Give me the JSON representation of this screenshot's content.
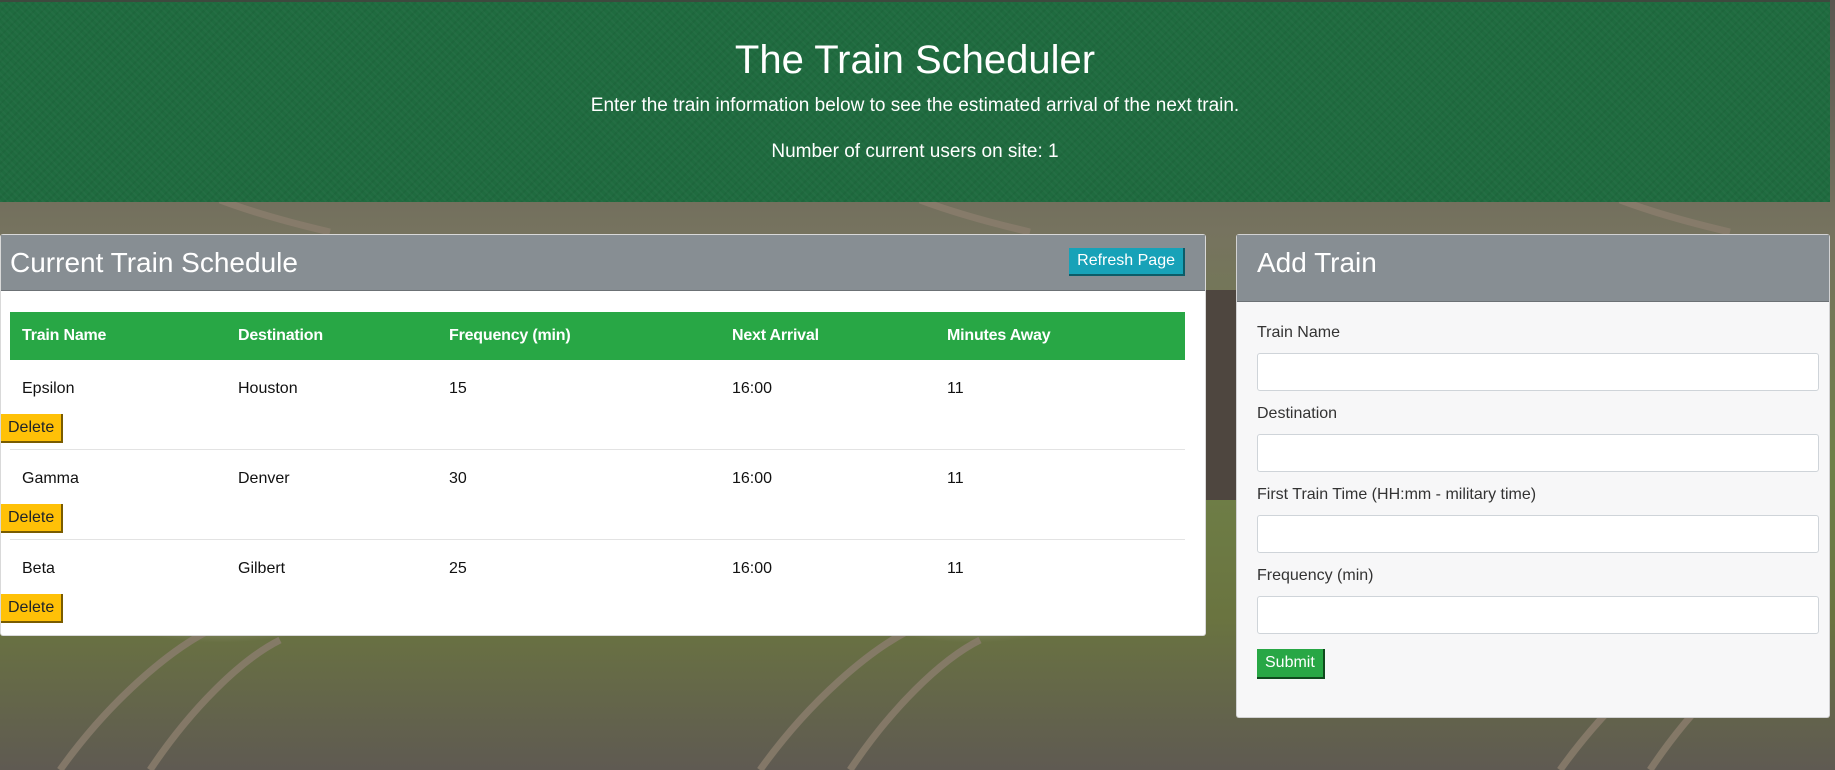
{
  "header": {
    "title": "The Train Scheduler",
    "subtitle": "Enter the train information below to see the estimated arrival of the next train.",
    "users_label": "Number of current users on site: 1"
  },
  "schedule": {
    "title": "Current Train Schedule",
    "refresh_label": "Refresh Page",
    "columns": [
      "Train Name",
      "Destination",
      "Frequency (min)",
      "Next Arrival",
      "Minutes Away"
    ],
    "rows": [
      {
        "name": "Epsilon",
        "destination": "Houston",
        "frequency": "15",
        "next_arrival": "16:00",
        "minutes_away": "11"
      },
      {
        "name": "Gamma",
        "destination": "Denver",
        "frequency": "30",
        "next_arrival": "16:00",
        "minutes_away": "11"
      },
      {
        "name": "Beta",
        "destination": "Gilbert",
        "frequency": "25",
        "next_arrival": "16:00",
        "minutes_away": "11"
      }
    ],
    "delete_label": "Delete"
  },
  "add_train": {
    "title": "Add Train",
    "fields": {
      "train_name": {
        "label": "Train Name",
        "value": "",
        "placeholder": ""
      },
      "destination": {
        "label": "Destination",
        "value": "",
        "placeholder": ""
      },
      "first_time": {
        "label": "First Train Time (HH:mm - military time)",
        "value": "",
        "placeholder": ""
      },
      "frequency": {
        "label": "Frequency (min)",
        "value": "",
        "placeholder": ""
      }
    },
    "submit_label": "Submit"
  },
  "colors": {
    "header_green": "#1f6b3f",
    "table_header_green": "#28a745",
    "card_header_gray": "#878e93",
    "refresh_teal": "#17a2b8",
    "delete_yellow": "#ffc107",
    "submit_green": "#28a745"
  }
}
